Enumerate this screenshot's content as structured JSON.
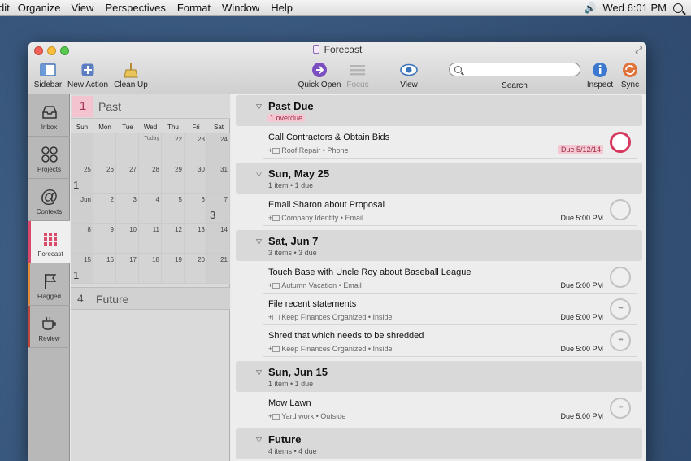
{
  "menubar": {
    "items": [
      "dit",
      "Organize",
      "View",
      "Perspectives",
      "Format",
      "Window",
      "Help"
    ],
    "clock": "Wed 6:01 PM"
  },
  "window": {
    "title": "Forecast"
  },
  "toolbar": {
    "sidebar": "Sidebar",
    "new_action": "New Action",
    "clean_up": "Clean Up",
    "quick_open": "Quick Open",
    "focus": "Focus",
    "view": "View",
    "search": "Search",
    "search_placeholder": "",
    "inspect": "Inspect",
    "sync": "Sync"
  },
  "perspectives": [
    "Inbox",
    "Projects",
    "Contexts",
    "Forecast",
    "Flagged",
    "Review"
  ],
  "calendar": {
    "past_count": "1",
    "past_label": "Past",
    "weekdays": [
      "Sun",
      "Mon",
      "Tue",
      "Wed",
      "Thu",
      "Fri",
      "Sat"
    ],
    "rows": [
      [
        {
          "d": ""
        },
        {
          "d": ""
        },
        {
          "d": ""
        },
        {
          "d": "Today"
        },
        {
          "d": "22"
        },
        {
          "d": "23"
        },
        {
          "d": "24"
        }
      ],
      [
        {
          "d": "25",
          "c": "1"
        },
        {
          "d": "26"
        },
        {
          "d": "27"
        },
        {
          "d": "28"
        },
        {
          "d": "29"
        },
        {
          "d": "30"
        },
        {
          "d": "31"
        }
      ],
      [
        {
          "d": "Jun"
        },
        {
          "d": "2"
        },
        {
          "d": "3"
        },
        {
          "d": "4"
        },
        {
          "d": "5"
        },
        {
          "d": "6"
        },
        {
          "d": "7",
          "c": "3"
        }
      ],
      [
        {
          "d": "8"
        },
        {
          "d": "9"
        },
        {
          "d": "10"
        },
        {
          "d": "11"
        },
        {
          "d": "12"
        },
        {
          "d": "13"
        },
        {
          "d": "14"
        }
      ],
      [
        {
          "d": "15",
          "c": "1"
        },
        {
          "d": "16"
        },
        {
          "d": "17"
        },
        {
          "d": "18"
        },
        {
          "d": "19"
        },
        {
          "d": "20"
        },
        {
          "d": "21"
        }
      ]
    ],
    "future_count": "4",
    "future_label": "Future"
  },
  "groups": [
    {
      "title": "Past Due",
      "sub": "1 overdue",
      "overdue": true,
      "tasks": [
        {
          "name": "Call Contractors & Obtain Bids",
          "meta": "Roof Repair • Phone",
          "due": "Due 5/12/14",
          "overdue": true,
          "dots": false
        }
      ]
    },
    {
      "title": "Sun, May 25",
      "sub": "1 item • 1 due",
      "tasks": [
        {
          "name": "Email Sharon about Proposal",
          "meta": "Company Identity • Email",
          "due": "Due 5:00 PM",
          "dots": false
        }
      ]
    },
    {
      "title": "Sat, Jun 7",
      "sub": "3 items • 3 due",
      "tasks": [
        {
          "name": "Touch Base with Uncle Roy about Baseball League",
          "meta": "Autumn Vacation • Email",
          "due": "Due 5:00 PM",
          "dots": false
        },
        {
          "name": "File recent statements",
          "meta": "Keep Finances Organized • Inside",
          "due": "Due 5:00 PM",
          "dots": true
        },
        {
          "name": "Shred that which needs to be shredded",
          "meta": "Keep Finances Organized • Inside",
          "due": "Due 5:00 PM",
          "dots": true
        }
      ]
    },
    {
      "title": "Sun, Jun 15",
      "sub": "1 item • 1 due",
      "tasks": [
        {
          "name": "Mow Lawn",
          "meta": "Yard work • Outside",
          "due": "Due 5:00 PM",
          "dots": true
        }
      ]
    },
    {
      "title": "Future",
      "sub": "4 items • 4 due",
      "tasks": []
    }
  ],
  "colors": {
    "accent_overdue": "#d6395e",
    "forecast_pink": "#d94a6a"
  }
}
